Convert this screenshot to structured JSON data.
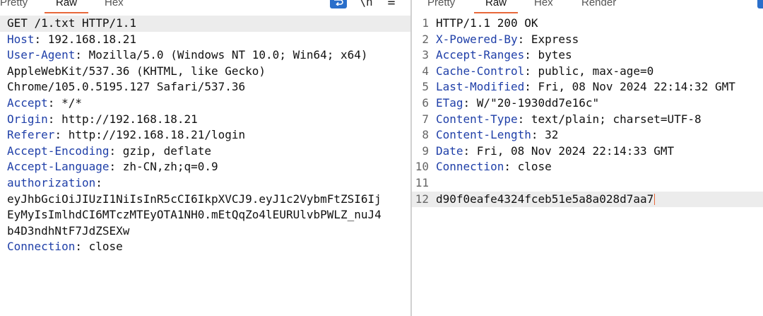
{
  "request_tabs": [
    "Pretty",
    "Raw",
    "Hex"
  ],
  "response_tabs": [
    "Pretty",
    "Raw",
    "Hex",
    "Render"
  ],
  "tools": {
    "wrap_icon": "word-wrap-icon",
    "newline_glyph": "\\n",
    "menu_glyph": "≡"
  },
  "request": {
    "request_line": "GET /1.txt HTTP/1.1",
    "headers": [
      {
        "name": "Host",
        "value": "192.168.18.21"
      },
      {
        "name": "User-Agent",
        "value": "Mozilla/5.0 (Windows NT 10.0; Win64; x64)"
      },
      {
        "cont": "AppleWebKit/537.36 (KHTML, like Gecko)"
      },
      {
        "cont": "Chrome/105.0.5195.127 Safari/537.36"
      },
      {
        "name": "Accept",
        "value": "*/*"
      },
      {
        "name": "Origin",
        "value": "http://192.168.18.21"
      },
      {
        "name": "Referer",
        "value": "http://192.168.18.21/login"
      },
      {
        "name": "Accept-Encoding",
        "value": "gzip, deflate"
      },
      {
        "name": "Accept-Language",
        "value": "zh-CN,zh;q=0.9"
      },
      {
        "name": "authorization",
        "value": ""
      },
      {
        "cont": "eyJhbGciOiJIUzI1NiIsInR5cCI6IkpXVCJ9.eyJ1c2VybmFtZSI6Ij"
      },
      {
        "cont": "EyMyIsImlhdCI6MTczMTEyOTA1NH0.mEtQqZo4lEURUlvbPWLZ_nuJ4"
      },
      {
        "cont": "b4D3ndhNtF7JdZSEXw"
      },
      {
        "name": "Connection",
        "value": "close"
      }
    ]
  },
  "response": {
    "lines": [
      {
        "num": "1",
        "text": "HTTP/1.1 200 OK"
      },
      {
        "num": "2",
        "name": "X-Powered-By",
        "value": "Express"
      },
      {
        "num": "3",
        "name": "Accept-Ranges",
        "value": "bytes"
      },
      {
        "num": "4",
        "name": "Cache-Control",
        "value": "public, max-age=0"
      },
      {
        "num": "5",
        "name": "Last-Modified",
        "value": "Fri, 08 Nov 2024 22:14:32 GMT"
      },
      {
        "num": "6",
        "name": "ETag",
        "value": "W/\"20-1930dd7e16c\""
      },
      {
        "num": "7",
        "name": "Content-Type",
        "value": "text/plain; charset=UTF-8"
      },
      {
        "num": "8",
        "name": "Content-Length",
        "value": "32"
      },
      {
        "num": "9",
        "name": "Date",
        "value": "Fri, 08 Nov 2024 22:14:33 GMT"
      },
      {
        "num": "10",
        "name": "Connection",
        "value": "close"
      },
      {
        "num": "11",
        "text": ""
      },
      {
        "num": "12",
        "text": "d90f0eafe4324fceb51e5a8a028d7aa7"
      }
    ]
  },
  "colors": {
    "header_name": "#1f3fa8",
    "accent": "#e8683a",
    "wrap_button": "#2a6fcb"
  }
}
